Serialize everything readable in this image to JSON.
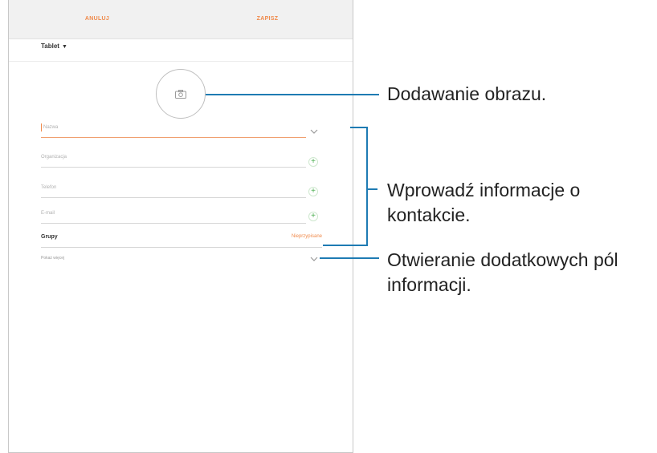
{
  "topbar": {
    "cancel_label": "ANULUJ",
    "save_label": "ZAPISZ"
  },
  "account": {
    "label": "Tablet"
  },
  "fields": {
    "name_placeholder": "Nazwa",
    "organization_placeholder": "Organizacja",
    "phone_placeholder": "Telefon",
    "email_placeholder": "E-mail"
  },
  "groups": {
    "label": "Grupy",
    "value": "Nieprzypisane"
  },
  "more_fields": {
    "label": "Pokaż więcej"
  },
  "callouts": {
    "add_image": "Dodawanie obrazu.",
    "enter_info_line1": "Wprowadź informacje o",
    "enter_info_line2": "kontakcie.",
    "open_more_line1": "Otwieranie dodatkowych pól",
    "open_more_line2": "informacji."
  },
  "colors": {
    "accent": "#f08a4b",
    "callout_line": "#1e7bb3",
    "plus_icon": "#4caf50"
  },
  "icons": [
    "camera-icon",
    "chevron-down-icon",
    "plus-icon"
  ]
}
